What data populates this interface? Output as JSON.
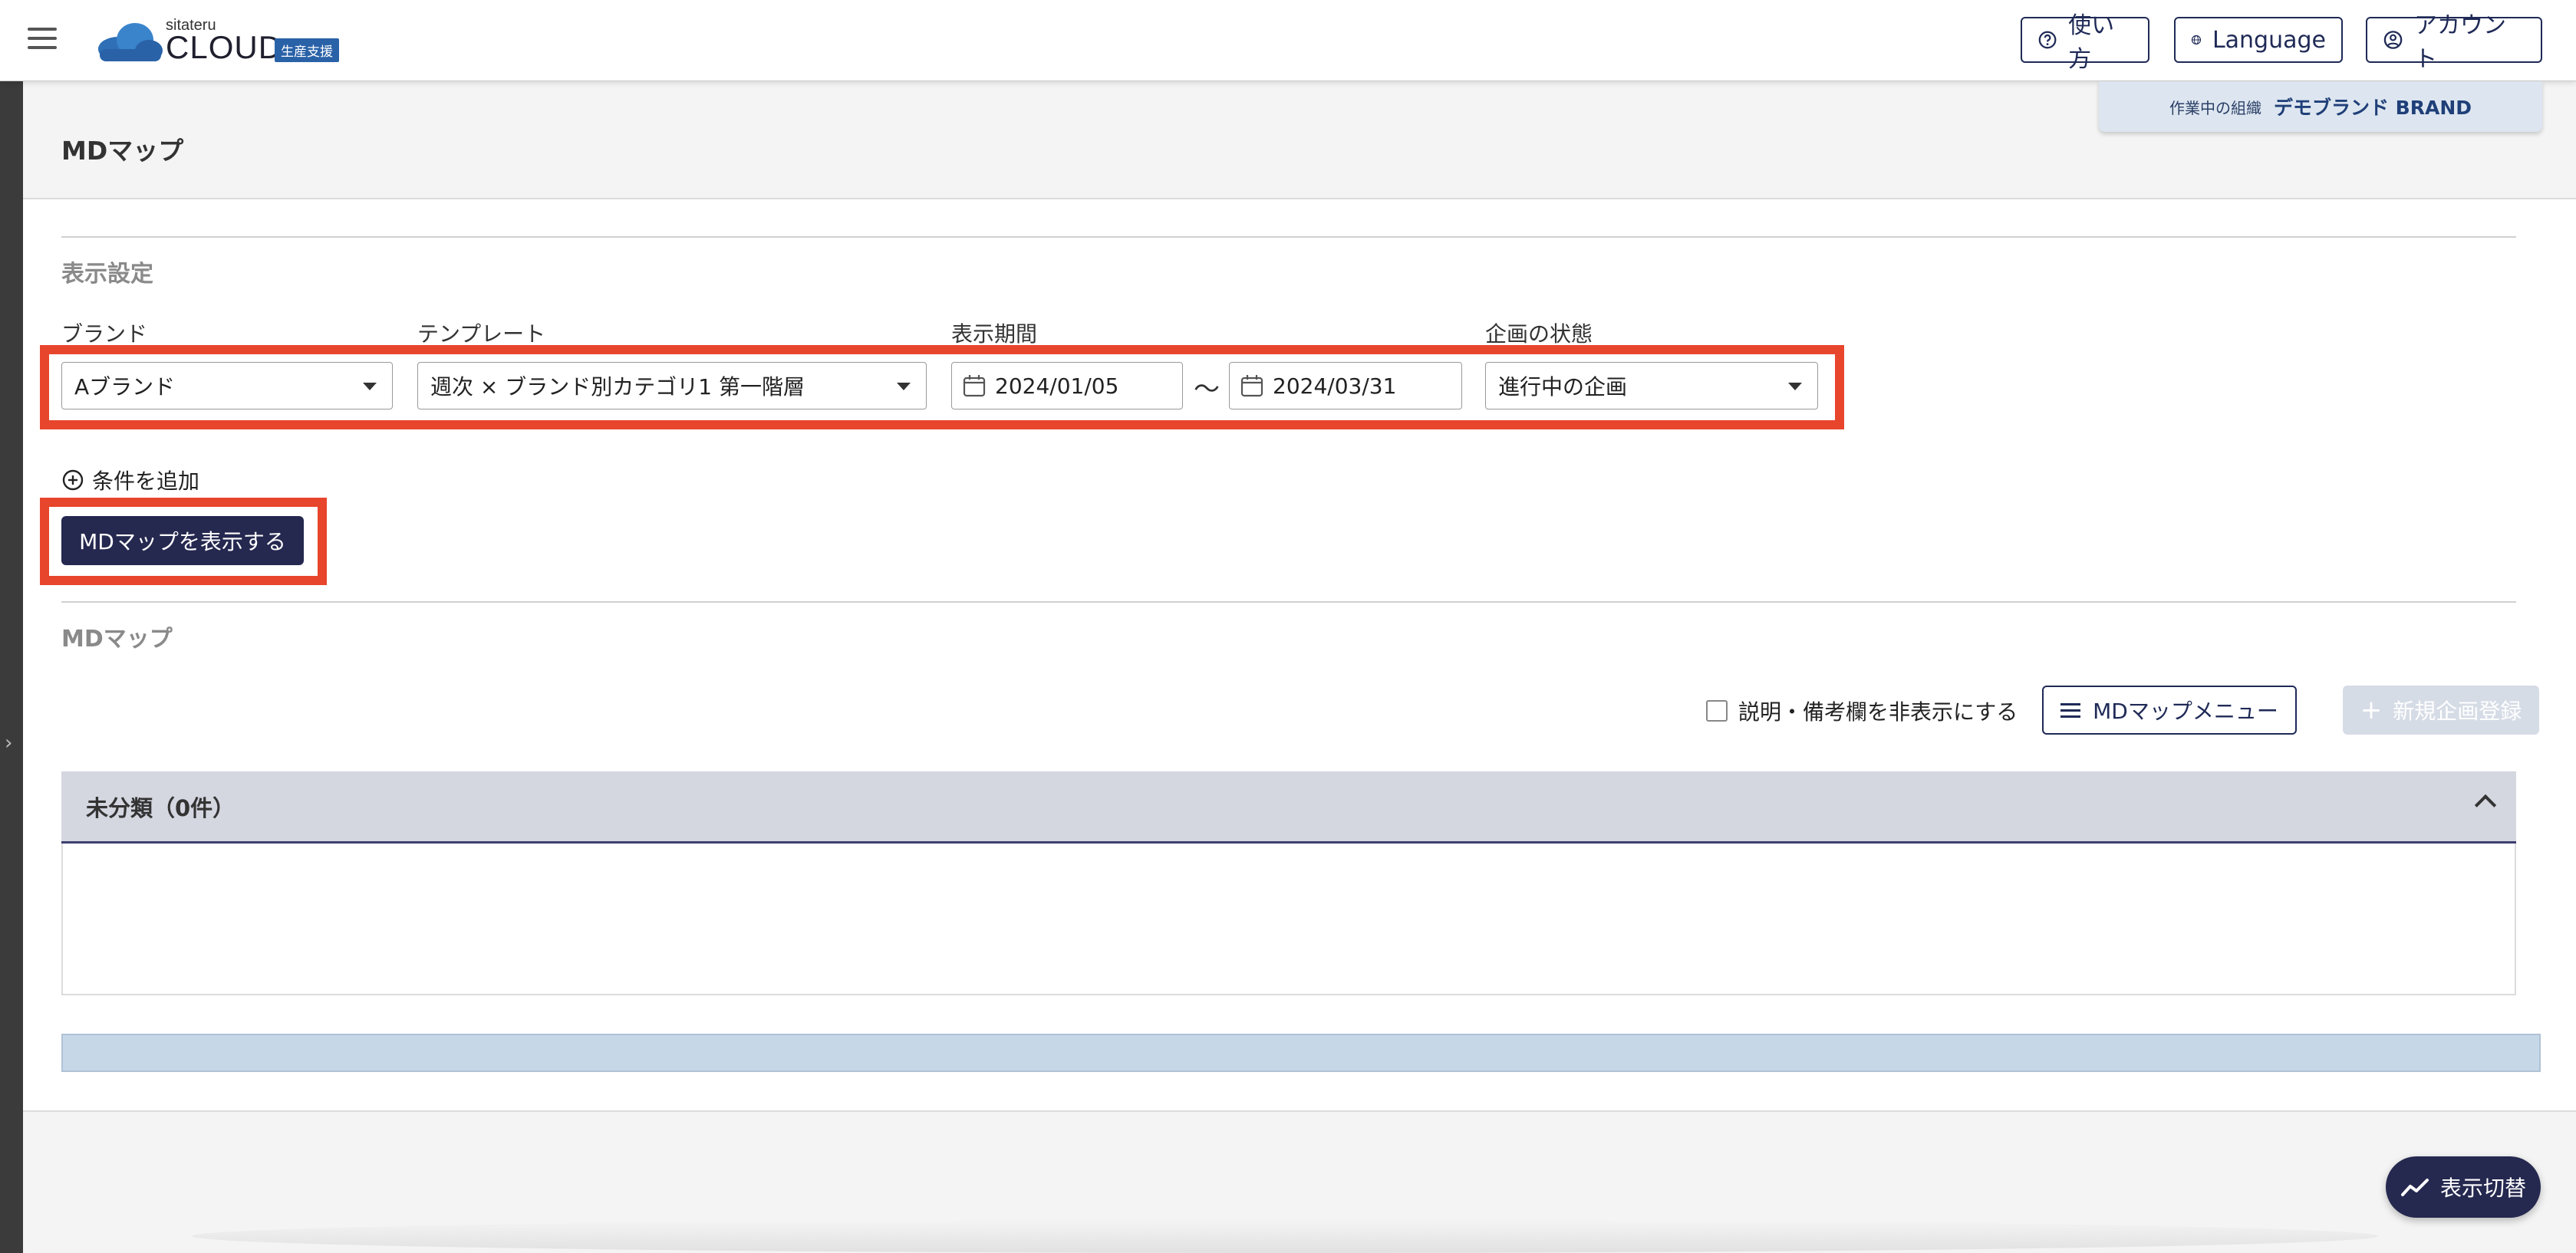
{
  "header": {
    "logo": {
      "small_text": "sitateru",
      "main_text": "CLOUD",
      "badge": "生産支援"
    },
    "help_label": "使い方",
    "language_label": "Language",
    "account_label": "アカウント"
  },
  "org": {
    "label": "作業中の組織",
    "name": "デモブランド BRAND"
  },
  "page": {
    "title": "MDマップ"
  },
  "display_settings": {
    "heading": "表示設定",
    "brand": {
      "label": "ブランド",
      "value": "Aブランド"
    },
    "template": {
      "label": "テンプレート",
      "value": "週次 × ブランド別カテゴリ1 第一階層"
    },
    "period": {
      "label": "表示期間",
      "start": "2024/01/05",
      "separator": "〜",
      "end": "2024/03/31"
    },
    "plan_state": {
      "label": "企画の状態",
      "value": "進行中の企画"
    },
    "add_condition_label": "条件を追加",
    "show_map_button": "MDマップを表示する"
  },
  "md_map": {
    "heading": "MDマップ",
    "hide_notes_checkbox": "説明・備考欄を非表示にする",
    "menu_button": "MDマップメニュー",
    "new_plan_button": "新規企画登録",
    "accordion": {
      "title": "未分類（0件）"
    }
  },
  "fab": {
    "label": "表示切替"
  },
  "colors": {
    "primary": "#25284f",
    "highlight": "#e8452d",
    "accordion_header": "#d4d6e0",
    "scrollbar": "#c6d7e8",
    "disabled_button": "#d6dce6"
  },
  "icons": {
    "menu": "hamburger-icon",
    "help": "question-circle-icon",
    "language": "globe-icon",
    "account": "user-circle-icon",
    "calendar": "calendar-icon",
    "add": "plus-circle-icon",
    "list": "list-icon",
    "chart": "trend-chart-icon"
  }
}
